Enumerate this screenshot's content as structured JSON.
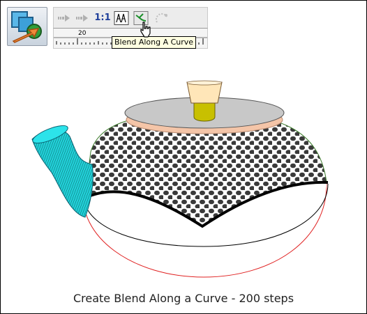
{
  "toolbar": {
    "one_to_one_label": "1:1",
    "ruler_marker": "20"
  },
  "tooltip": {
    "text": "Blend Along A Curve"
  },
  "caption": "Create Blend Along a Curve - 200 steps",
  "icons": [
    "blend-tool-icon",
    "prev-blend-icon",
    "next-blend-icon",
    "one-to-one-icon",
    "tile-blend-icon",
    "blend-along-curve-icon",
    "remove-blend-icon",
    "cursor-icon"
  ],
  "colors": {
    "tooltip_bg": "#ffffe1",
    "spout": "#00c8d0",
    "lid": "#c8c8c8",
    "knob": "#c8c000",
    "curve": "#e02020"
  }
}
